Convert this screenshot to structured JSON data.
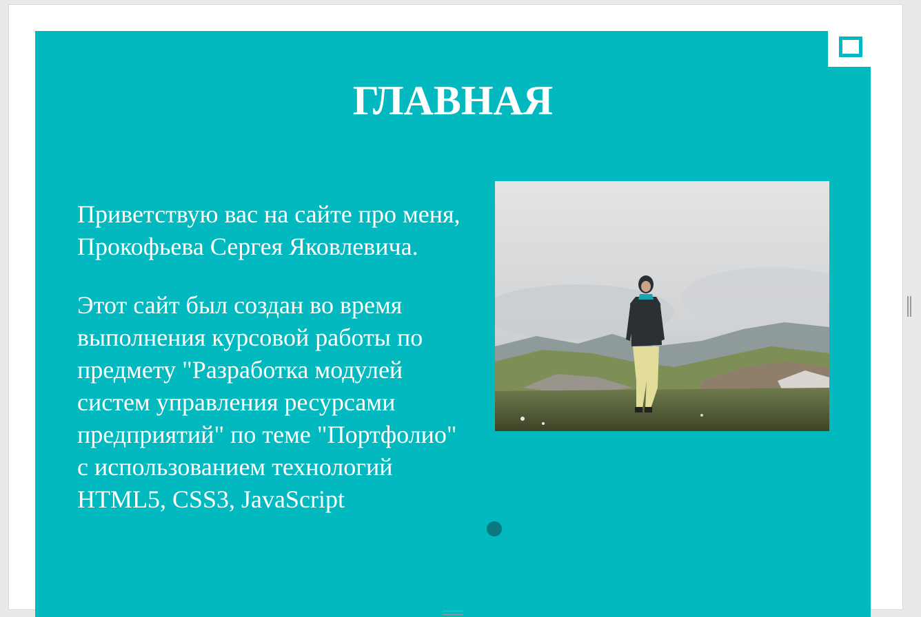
{
  "page": {
    "title": "ГЛАВНАЯ",
    "paragraphs": [
      "Приветствую вас на сайте про меня, Прокофьева Сергея Яковлевича.",
      "Этот сайт был создан во время выполнения курсовой работы по предмету \"Разработка модулей систем управления ресурсами предприятий\" по теме \"Портфолио\" с использованием технологий HTML5, CSS3, JavaScript"
    ]
  },
  "menu_button": {
    "icon": "menu-square-icon"
  },
  "colors": {
    "accent": "#02b9c0",
    "text": "#ffffff",
    "cursor": "#0b6f75"
  }
}
